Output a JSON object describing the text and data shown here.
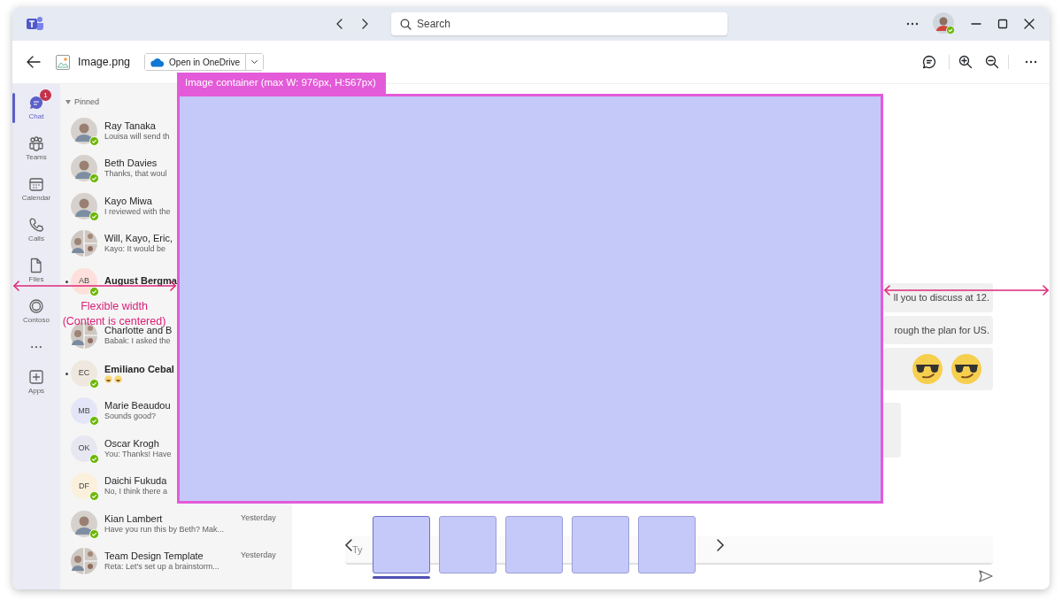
{
  "title_bar": {
    "search": {
      "placeholder": "Search"
    }
  },
  "viewer_toolbar": {
    "file_name": "Image.png",
    "open_button": "Open in OneDrive"
  },
  "rail": [
    {
      "kind": "chat",
      "label": "Chat",
      "badge": "1",
      "selected": true
    },
    {
      "kind": "teams",
      "label": "Teams",
      "selected": false
    },
    {
      "kind": "calendar",
      "label": "Calendar",
      "selected": false
    },
    {
      "kind": "calls",
      "label": "Calls",
      "selected": false
    },
    {
      "kind": "files",
      "label": "Files",
      "selected": false
    },
    {
      "kind": "contoso",
      "label": "Contoso",
      "selected": false
    },
    {
      "kind": "more",
      "selected": false
    },
    {
      "kind": "apps",
      "label": "Apps",
      "selected": false
    }
  ],
  "chat_list": {
    "section": "Pinned",
    "chats": [
      {
        "kind": "photo",
        "name": "Ray Tanaka",
        "preview": "Louisa will send th",
        "unread": false,
        "presence": true
      },
      {
        "kind": "photo",
        "name": "Beth Davies",
        "preview": "Thanks, that woul",
        "unread": false,
        "presence": true
      },
      {
        "kind": "photo",
        "name": "Kayo Miwa",
        "preview": "I reviewed with the",
        "unread": false,
        "presence": true
      },
      {
        "kind": "group",
        "name": "Will, Kayo, Eric,",
        "preview": "Kayo: It would be",
        "unread": false,
        "presence": false
      },
      {
        "kind": "initials",
        "initials": "AB",
        "name": "August Bergma",
        "unread": true,
        "presence": true
      },
      {
        "kind": "group",
        "name": "Charlotte and B",
        "preview": "Babak: I asked the",
        "unread": false,
        "presence": false
      },
      {
        "kind": "initials",
        "initials": "EC",
        "name": "Emiliano Cebal",
        "emoji_preview": true,
        "unread": true,
        "presence": true
      },
      {
        "kind": "initials",
        "initials": "MB",
        "name": "Marie Beaudou",
        "preview": "Sounds good?",
        "unread": false,
        "presence": true
      },
      {
        "kind": "initials",
        "initials": "OK",
        "name": "Oscar Krogh",
        "preview": "You: Thanks! Have",
        "unread": false,
        "presence": true
      },
      {
        "kind": "initials",
        "initials": "DF",
        "name": "Daichi Fukuda",
        "preview": "No, I think there a",
        "unread": false,
        "presence": true
      },
      {
        "kind": "photo",
        "name": "Kian Lambert",
        "preview": "Have you run this by Beth? Mak...",
        "time": "Yesterday",
        "unread": false,
        "presence": true
      },
      {
        "kind": "group",
        "name": "Team Design Template",
        "preview": "Reta: Let's set up a brainstorm...",
        "time": "Yesterday",
        "unread": false,
        "presence": false
      }
    ]
  },
  "conversation": {
    "messages": [
      {
        "kind": "text",
        "text": "ll you to discuss at 12."
      },
      {
        "kind": "text",
        "text": "rough the plan for US."
      },
      {
        "kind": "emojis"
      },
      {
        "kind": "blank"
      }
    ],
    "compose": {
      "text": "Ty"
    }
  },
  "annotations": {
    "container_label": "Image container (max W: 976px, H:567px)",
    "side_note": [
      "Flexible width",
      "(Content is centered)"
    ]
  },
  "thumbnails": [
    {
      "selected": true
    },
    {
      "selected": false
    },
    {
      "selected": false
    },
    {
      "selected": false
    },
    {
      "selected": false
    }
  ]
}
